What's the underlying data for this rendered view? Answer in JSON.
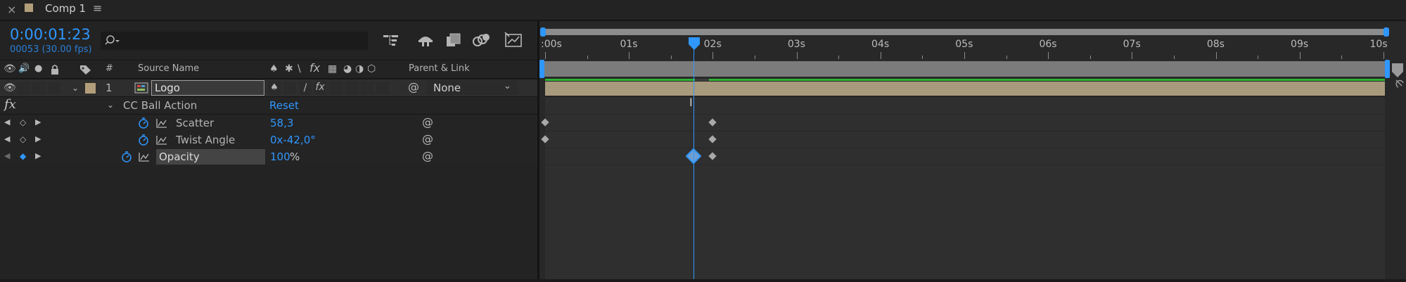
{
  "tab": {
    "title": "Comp 1",
    "close": "×",
    "menu": "≡"
  },
  "header": {
    "timecode": "0:00:01:23",
    "frame_info": "00053 (30.00 fps)",
    "search_placeholder": ""
  },
  "columns": {
    "source_name": "Source Name",
    "number": "#",
    "parent_link": "Parent & Link"
  },
  "layer": {
    "number": "1",
    "name": "Logo",
    "parent": "None"
  },
  "effect": {
    "fx_label": "fx",
    "name": "CC Ball Action",
    "reset": "Reset"
  },
  "properties": [
    {
      "name": "Scatter",
      "value": "58,3",
      "unit": ""
    },
    {
      "name": "Twist Angle",
      "value": "0x-42,0°",
      "unit": ""
    },
    {
      "name": "Opacity",
      "value": "100",
      "unit": "%"
    }
  ],
  "timeline": {
    "ruler_labels": [
      ":00s",
      "01s",
      "02s",
      "03s",
      "04s",
      "05s",
      "06s",
      "07s",
      "08s",
      "09s",
      "10s"
    ],
    "current_time_seconds": 1.77,
    "duration_seconds": 10,
    "keyframes": {
      "Scatter": [
        0,
        2
      ],
      "Twist Angle": [
        0,
        2
      ],
      "Opacity": [
        1.77,
        2
      ]
    }
  },
  "colors": {
    "accent_blue": "#2f97ff",
    "layer_bar": "#a89a7c",
    "layer_label": "#b29e7a",
    "work_area": "#2fb336"
  }
}
